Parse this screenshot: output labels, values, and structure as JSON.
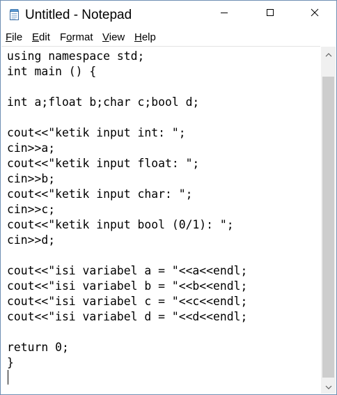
{
  "window": {
    "title": "Untitled - Notepad"
  },
  "menu": {
    "file": {
      "acc": "F",
      "rest": "ile"
    },
    "edit": {
      "acc": "E",
      "rest": "dit"
    },
    "format": {
      "pre": "F",
      "acc": "o",
      "rest": "rmat"
    },
    "view": {
      "acc": "V",
      "rest": "iew"
    },
    "help": {
      "acc": "H",
      "rest": "elp"
    }
  },
  "editor": {
    "lines": [
      "using namespace std;",
      "int main () {",
      "",
      "int a;float b;char c;bool d;",
      "",
      "cout<<\"ketik input int: \";",
      "cin>>a;",
      "cout<<\"ketik input float: \";",
      "cin>>b;",
      "cout<<\"ketik input char: \";",
      "cin>>c;",
      "cout<<\"ketik input bool (0/1): \";",
      "cin>>d;",
      "",
      "cout<<\"isi variabel a = \"<<a<<endl;",
      "cout<<\"isi variabel b = \"<<b<<endl;",
      "cout<<\"isi variabel c = \"<<c<<endl;",
      "cout<<\"isi variabel d = \"<<d<<endl;",
      "",
      "return 0;",
      "}"
    ]
  },
  "icons": {
    "app": "notepad-icon",
    "minimize": "minimize-icon",
    "maximize": "maximize-icon",
    "close": "close-icon",
    "scroll_up": "chevron-up-icon",
    "scroll_down": "chevron-down-icon"
  },
  "colors": {
    "window_border": "#6f8fb3",
    "scrollbar_track": "#f0f0f0",
    "scrollbar_thumb": "#cdcdcd"
  }
}
